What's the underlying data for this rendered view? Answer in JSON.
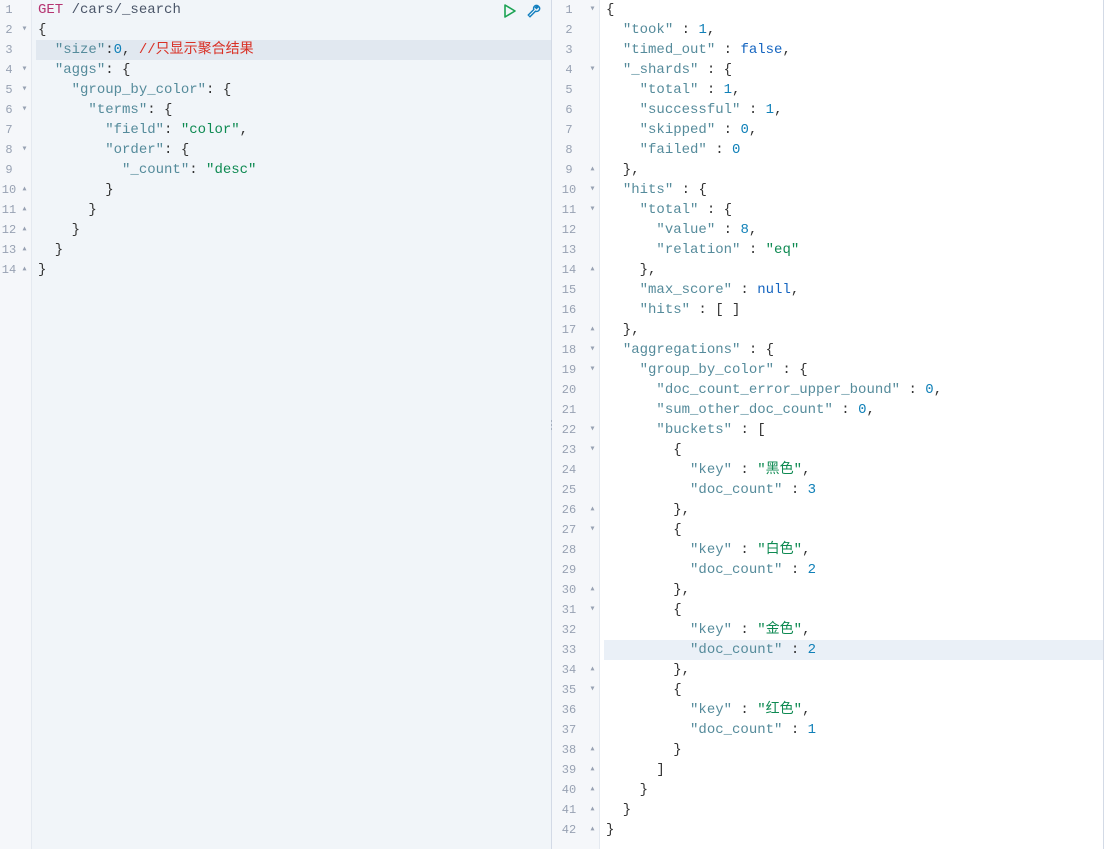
{
  "left": {
    "method": "GET",
    "path": "/cars/_search",
    "size_comment": "//只显示聚合结果",
    "lines": [
      {
        "n": 1,
        "fold": "",
        "parts": [
          [
            "method",
            "GET"
          ],
          [
            "punc",
            " "
          ],
          [
            "path",
            "/cars/_search"
          ]
        ]
      },
      {
        "n": 2,
        "fold": "▾",
        "parts": [
          [
            "punc",
            "{"
          ]
        ]
      },
      {
        "n": 3,
        "fold": "",
        "hl": true,
        "parts": [
          [
            "punc",
            "  "
          ],
          [
            "key",
            "\"size\""
          ],
          [
            "punc",
            ":"
          ],
          [
            "num",
            "0"
          ],
          [
            "punc",
            ", "
          ],
          [
            "comment",
            "//只显示聚合结果"
          ]
        ]
      },
      {
        "n": 4,
        "fold": "▾",
        "parts": [
          [
            "punc",
            "  "
          ],
          [
            "key",
            "\"aggs\""
          ],
          [
            "punc",
            ": {"
          ]
        ]
      },
      {
        "n": 5,
        "fold": "▾",
        "parts": [
          [
            "punc",
            "    "
          ],
          [
            "key",
            "\"group_by_color\""
          ],
          [
            "punc",
            ": {"
          ]
        ]
      },
      {
        "n": 6,
        "fold": "▾",
        "parts": [
          [
            "punc",
            "      "
          ],
          [
            "key",
            "\"terms\""
          ],
          [
            "punc",
            ": {"
          ]
        ]
      },
      {
        "n": 7,
        "fold": "",
        "parts": [
          [
            "punc",
            "        "
          ],
          [
            "key",
            "\"field\""
          ],
          [
            "punc",
            ": "
          ],
          [
            "str",
            "\"color\""
          ],
          [
            "punc",
            ","
          ]
        ]
      },
      {
        "n": 8,
        "fold": "▾",
        "parts": [
          [
            "punc",
            "        "
          ],
          [
            "key",
            "\"order\""
          ],
          [
            "punc",
            ": {"
          ]
        ]
      },
      {
        "n": 9,
        "fold": "",
        "parts": [
          [
            "punc",
            "          "
          ],
          [
            "key",
            "\"_count\""
          ],
          [
            "punc",
            ": "
          ],
          [
            "str",
            "\"desc\""
          ]
        ]
      },
      {
        "n": 10,
        "fold": "▴",
        "parts": [
          [
            "punc",
            "        }"
          ]
        ]
      },
      {
        "n": 11,
        "fold": "▴",
        "parts": [
          [
            "punc",
            "      }"
          ]
        ]
      },
      {
        "n": 12,
        "fold": "▴",
        "parts": [
          [
            "punc",
            "    }"
          ]
        ]
      },
      {
        "n": 13,
        "fold": "▴",
        "parts": [
          [
            "punc",
            "  }"
          ]
        ]
      },
      {
        "n": 14,
        "fold": "▴",
        "parts": [
          [
            "punc",
            "}"
          ]
        ]
      }
    ]
  },
  "right": {
    "lines": [
      {
        "n": 1,
        "fold": "▾",
        "parts": [
          [
            "punc",
            "{"
          ]
        ]
      },
      {
        "n": 2,
        "fold": "",
        "parts": [
          [
            "punc",
            "  "
          ],
          [
            "key",
            "\"took\""
          ],
          [
            "punc",
            " : "
          ],
          [
            "num",
            "1"
          ],
          [
            "punc",
            ","
          ]
        ]
      },
      {
        "n": 3,
        "fold": "",
        "parts": [
          [
            "punc",
            "  "
          ],
          [
            "key",
            "\"timed_out\""
          ],
          [
            "punc",
            " : "
          ],
          [
            "bool",
            "false"
          ],
          [
            "punc",
            ","
          ]
        ]
      },
      {
        "n": 4,
        "fold": "▾",
        "parts": [
          [
            "punc",
            "  "
          ],
          [
            "key",
            "\"_shards\""
          ],
          [
            "punc",
            " : {"
          ]
        ]
      },
      {
        "n": 5,
        "fold": "",
        "parts": [
          [
            "punc",
            "    "
          ],
          [
            "key",
            "\"total\""
          ],
          [
            "punc",
            " : "
          ],
          [
            "num",
            "1"
          ],
          [
            "punc",
            ","
          ]
        ]
      },
      {
        "n": 6,
        "fold": "",
        "parts": [
          [
            "punc",
            "    "
          ],
          [
            "key",
            "\"successful\""
          ],
          [
            "punc",
            " : "
          ],
          [
            "num",
            "1"
          ],
          [
            "punc",
            ","
          ]
        ]
      },
      {
        "n": 7,
        "fold": "",
        "parts": [
          [
            "punc",
            "    "
          ],
          [
            "key",
            "\"skipped\""
          ],
          [
            "punc",
            " : "
          ],
          [
            "num",
            "0"
          ],
          [
            "punc",
            ","
          ]
        ]
      },
      {
        "n": 8,
        "fold": "",
        "parts": [
          [
            "punc",
            "    "
          ],
          [
            "key",
            "\"failed\""
          ],
          [
            "punc",
            " : "
          ],
          [
            "num",
            "0"
          ]
        ]
      },
      {
        "n": 9,
        "fold": "▴",
        "parts": [
          [
            "punc",
            "  },"
          ]
        ]
      },
      {
        "n": 10,
        "fold": "▾",
        "parts": [
          [
            "punc",
            "  "
          ],
          [
            "key",
            "\"hits\""
          ],
          [
            "punc",
            " : {"
          ]
        ]
      },
      {
        "n": 11,
        "fold": "▾",
        "parts": [
          [
            "punc",
            "    "
          ],
          [
            "key",
            "\"total\""
          ],
          [
            "punc",
            " : {"
          ]
        ]
      },
      {
        "n": 12,
        "fold": "",
        "parts": [
          [
            "punc",
            "      "
          ],
          [
            "key",
            "\"value\""
          ],
          [
            "punc",
            " : "
          ],
          [
            "num",
            "8"
          ],
          [
            "punc",
            ","
          ]
        ]
      },
      {
        "n": 13,
        "fold": "",
        "parts": [
          [
            "punc",
            "      "
          ],
          [
            "key",
            "\"relation\""
          ],
          [
            "punc",
            " : "
          ],
          [
            "str",
            "\"eq\""
          ]
        ]
      },
      {
        "n": 14,
        "fold": "▴",
        "parts": [
          [
            "punc",
            "    },"
          ]
        ]
      },
      {
        "n": 15,
        "fold": "",
        "parts": [
          [
            "punc",
            "    "
          ],
          [
            "key",
            "\"max_score\""
          ],
          [
            "punc",
            " : "
          ],
          [
            "null",
            "null"
          ],
          [
            "punc",
            ","
          ]
        ]
      },
      {
        "n": 16,
        "fold": "",
        "parts": [
          [
            "punc",
            "    "
          ],
          [
            "key",
            "\"hits\""
          ],
          [
            "punc",
            " : [ ]"
          ]
        ]
      },
      {
        "n": 17,
        "fold": "▴",
        "parts": [
          [
            "punc",
            "  },"
          ]
        ]
      },
      {
        "n": 18,
        "fold": "▾",
        "parts": [
          [
            "punc",
            "  "
          ],
          [
            "key",
            "\"aggregations\""
          ],
          [
            "punc",
            " : {"
          ]
        ]
      },
      {
        "n": 19,
        "fold": "▾",
        "parts": [
          [
            "punc",
            "    "
          ],
          [
            "key",
            "\"group_by_color\""
          ],
          [
            "punc",
            " : {"
          ]
        ]
      },
      {
        "n": 20,
        "fold": "",
        "parts": [
          [
            "punc",
            "      "
          ],
          [
            "key",
            "\"doc_count_error_upper_bound\""
          ],
          [
            "punc",
            " : "
          ],
          [
            "num",
            "0"
          ],
          [
            "punc",
            ","
          ]
        ]
      },
      {
        "n": 21,
        "fold": "",
        "parts": [
          [
            "punc",
            "      "
          ],
          [
            "key",
            "\"sum_other_doc_count\""
          ],
          [
            "punc",
            " : "
          ],
          [
            "num",
            "0"
          ],
          [
            "punc",
            ","
          ]
        ]
      },
      {
        "n": 22,
        "fold": "▾",
        "parts": [
          [
            "punc",
            "      "
          ],
          [
            "key",
            "\"buckets\""
          ],
          [
            "punc",
            " : ["
          ]
        ]
      },
      {
        "n": 23,
        "fold": "▾",
        "parts": [
          [
            "punc",
            "        {"
          ]
        ]
      },
      {
        "n": 24,
        "fold": "",
        "parts": [
          [
            "punc",
            "          "
          ],
          [
            "key",
            "\"key\""
          ],
          [
            "punc",
            " : "
          ],
          [
            "str",
            "\"黑色\""
          ],
          [
            "punc",
            ","
          ]
        ]
      },
      {
        "n": 25,
        "fold": "",
        "parts": [
          [
            "punc",
            "          "
          ],
          [
            "key",
            "\"doc_count\""
          ],
          [
            "punc",
            " : "
          ],
          [
            "num",
            "3"
          ]
        ]
      },
      {
        "n": 26,
        "fold": "▴",
        "parts": [
          [
            "punc",
            "        },"
          ]
        ]
      },
      {
        "n": 27,
        "fold": "▾",
        "parts": [
          [
            "punc",
            "        {"
          ]
        ]
      },
      {
        "n": 28,
        "fold": "",
        "parts": [
          [
            "punc",
            "          "
          ],
          [
            "key",
            "\"key\""
          ],
          [
            "punc",
            " : "
          ],
          [
            "str",
            "\"白色\""
          ],
          [
            "punc",
            ","
          ]
        ]
      },
      {
        "n": 29,
        "fold": "",
        "parts": [
          [
            "punc",
            "          "
          ],
          [
            "key",
            "\"doc_count\""
          ],
          [
            "punc",
            " : "
          ],
          [
            "num",
            "2"
          ]
        ]
      },
      {
        "n": 30,
        "fold": "▴",
        "parts": [
          [
            "punc",
            "        },"
          ]
        ]
      },
      {
        "n": 31,
        "fold": "▾",
        "parts": [
          [
            "punc",
            "        {"
          ]
        ]
      },
      {
        "n": 32,
        "fold": "",
        "parts": [
          [
            "punc",
            "          "
          ],
          [
            "key",
            "\"key\""
          ],
          [
            "punc",
            " : "
          ],
          [
            "str",
            "\"金色\""
          ],
          [
            "punc",
            ","
          ]
        ]
      },
      {
        "n": 33,
        "fold": "",
        "hl": true,
        "parts": [
          [
            "punc",
            "          "
          ],
          [
            "key",
            "\"doc_count\""
          ],
          [
            "punc",
            " : "
          ],
          [
            "num",
            "2"
          ]
        ]
      },
      {
        "n": 34,
        "fold": "▴",
        "parts": [
          [
            "punc",
            "        },"
          ]
        ]
      },
      {
        "n": 35,
        "fold": "▾",
        "parts": [
          [
            "punc",
            "        {"
          ]
        ]
      },
      {
        "n": 36,
        "fold": "",
        "parts": [
          [
            "punc",
            "          "
          ],
          [
            "key",
            "\"key\""
          ],
          [
            "punc",
            " : "
          ],
          [
            "str",
            "\"红色\""
          ],
          [
            "punc",
            ","
          ]
        ]
      },
      {
        "n": 37,
        "fold": "",
        "parts": [
          [
            "punc",
            "          "
          ],
          [
            "key",
            "\"doc_count\""
          ],
          [
            "punc",
            " : "
          ],
          [
            "num",
            "1"
          ]
        ]
      },
      {
        "n": 38,
        "fold": "▴",
        "parts": [
          [
            "punc",
            "        }"
          ]
        ]
      },
      {
        "n": 39,
        "fold": "▴",
        "parts": [
          [
            "punc",
            "      ]"
          ]
        ]
      },
      {
        "n": 40,
        "fold": "▴",
        "parts": [
          [
            "punc",
            "    }"
          ]
        ]
      },
      {
        "n": 41,
        "fold": "▴",
        "parts": [
          [
            "punc",
            "  }"
          ]
        ]
      },
      {
        "n": 42,
        "fold": "▴",
        "parts": [
          [
            "punc",
            "}"
          ]
        ]
      }
    ]
  }
}
